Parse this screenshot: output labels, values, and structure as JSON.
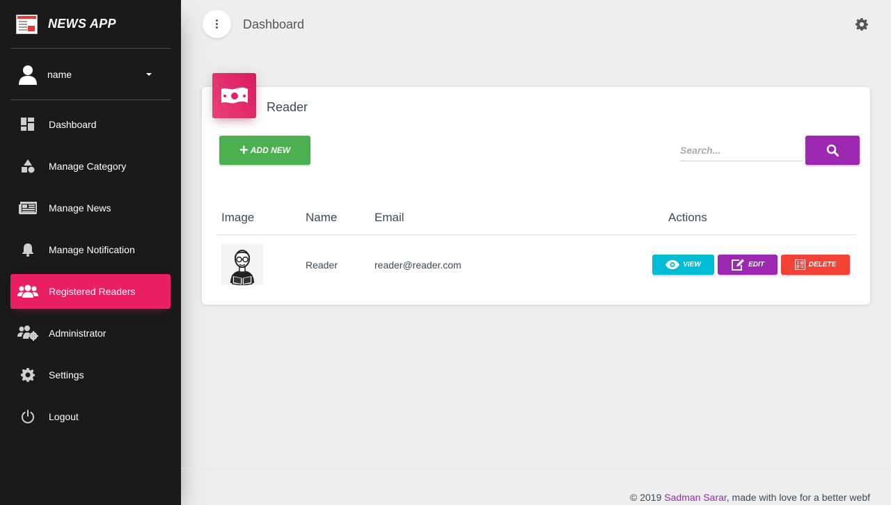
{
  "app": {
    "name": "NEWS APP"
  },
  "user": {
    "name": "name"
  },
  "sidebar": {
    "items": [
      {
        "label": "Dashboard",
        "icon": "dashboard-icon",
        "active": false
      },
      {
        "label": "Manage Category",
        "icon": "shapes-icon",
        "active": false
      },
      {
        "label": "Manage News",
        "icon": "newspaper-icon",
        "active": false
      },
      {
        "label": "Manage Notification",
        "icon": "bell-icon",
        "active": false
      },
      {
        "label": "Registered Readers",
        "icon": "users-icon",
        "active": true
      },
      {
        "label": "Administrator",
        "icon": "users-gear-icon",
        "active": false
      },
      {
        "label": "Settings",
        "icon": "gear-icon",
        "active": false
      },
      {
        "label": "Logout",
        "icon": "power-icon",
        "active": false
      }
    ]
  },
  "header": {
    "title": "Dashboard"
  },
  "card": {
    "title": "Reader",
    "add_button": "ADD NEW",
    "search_placeholder": "Search..."
  },
  "table": {
    "columns": [
      "Image",
      "Name",
      "Email",
      "Actions"
    ],
    "rows": [
      {
        "name": "Reader",
        "email": "reader@reader.com"
      }
    ],
    "actions": {
      "view": "VIEW",
      "edit": "EDIT",
      "delete": "DELETE"
    }
  },
  "footer": {
    "prefix": "© 2019 ",
    "author": "Sadman Sarar",
    "suffix": ", made with love for a better webf"
  },
  "colors": {
    "sidebar_bg": "#1a1a1a",
    "accent_pink": "#e91e63",
    "green": "#4caf50",
    "purple": "#9c27b0",
    "cyan": "#00bcd4",
    "red": "#f44336"
  }
}
